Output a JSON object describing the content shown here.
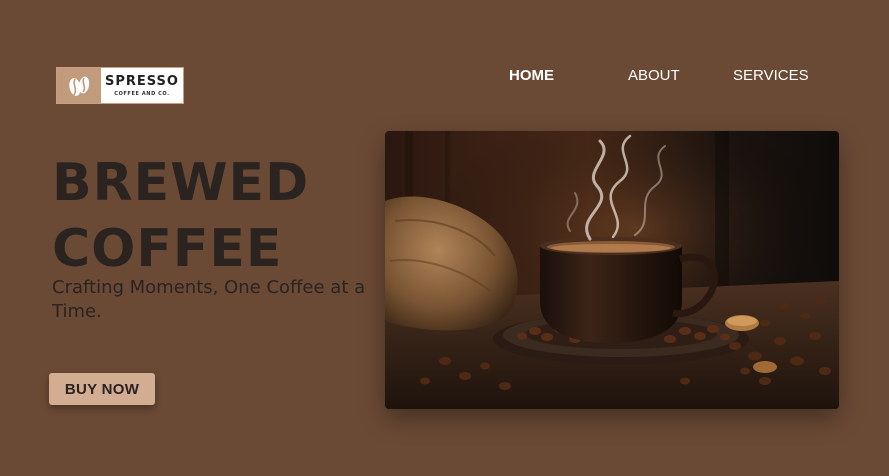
{
  "brand": {
    "name": "SPRESSO",
    "tagline": "COFFEE AND CO.",
    "icon": "coffee-bean-icon",
    "mark_color": "#c29a7c"
  },
  "nav": {
    "items": [
      {
        "label": "HOME",
        "active": true
      },
      {
        "label": "ABOUT",
        "active": false
      },
      {
        "label": "SERVICES",
        "active": false
      }
    ]
  },
  "hero": {
    "title_line1": "BREWED",
    "title_line2": "COFFEE",
    "subtitle": "Crafting Moments, One Coffee at a Time.",
    "cta_label": "BUY NOW",
    "image": "steaming-coffee-cup-photo"
  },
  "colors": {
    "background": "#6b4a35",
    "heading": "#2a2320",
    "button": "#d3ad91",
    "nav_text": "#ffffff"
  }
}
